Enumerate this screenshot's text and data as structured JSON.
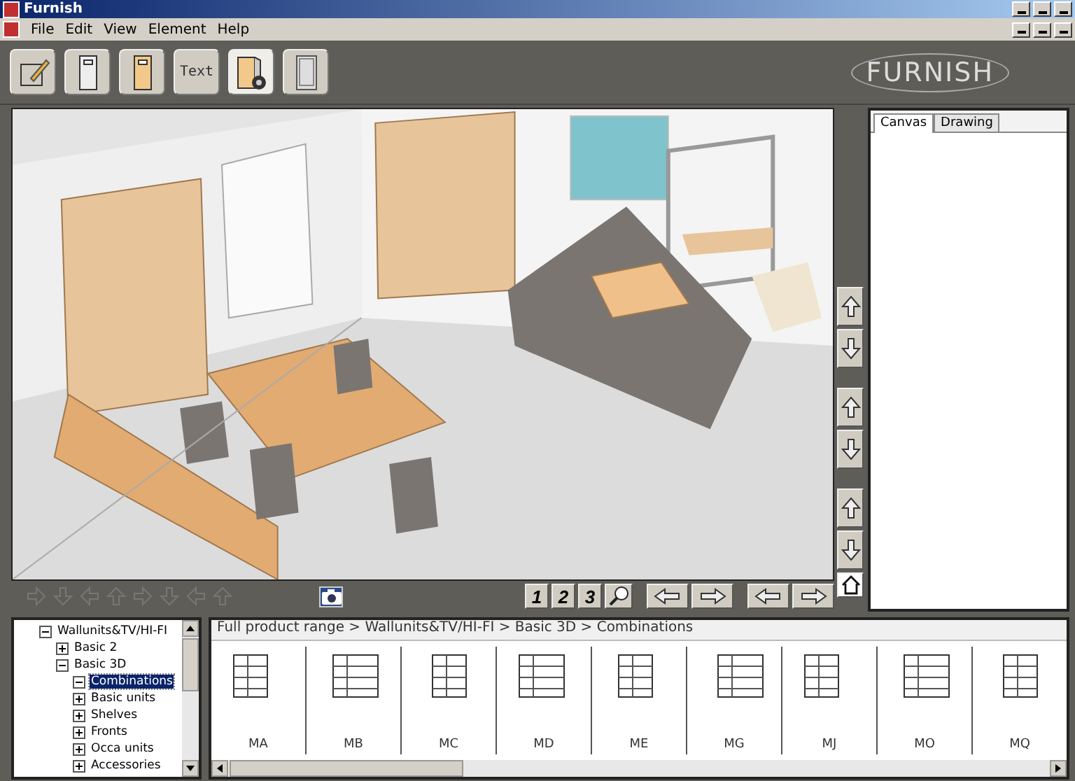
{
  "window": {
    "title": "Furnish"
  },
  "menu": [
    "File",
    "Edit",
    "View",
    "Element",
    "Help"
  ],
  "toolbar": [
    {
      "kind": "pencil",
      "selected": false
    },
    {
      "kind": "door",
      "selected": false
    },
    {
      "kind": "cabinet",
      "selected": false
    },
    {
      "kind": "text",
      "label": "Text",
      "selected": false
    },
    {
      "kind": "cabinet3d",
      "selected": true
    },
    {
      "kind": "calculator",
      "selected": false
    }
  ],
  "logo": "FURNISH",
  "tabs": [
    {
      "label": "Canvas",
      "selected": true
    },
    {
      "label": "Drawing",
      "selected": false
    }
  ],
  "view_pages": [
    {
      "label": "1"
    },
    {
      "label": "2"
    },
    {
      "label": "3"
    }
  ],
  "tree": [
    {
      "label": "Wallunits&TV/HI-FI",
      "expanded": true,
      "selected": false,
      "children": [
        {
          "label": "Basic 2",
          "expanded": false,
          "selected": false
        },
        {
          "label": "Basic 3D",
          "expanded": true,
          "selected": false,
          "children": [
            {
              "label": "Combinations",
              "expanded": true,
              "selected": true
            },
            {
              "label": "Basic units",
              "expanded": false,
              "selected": false
            },
            {
              "label": "Shelves",
              "expanded": false,
              "selected": false
            },
            {
              "label": "Fronts",
              "expanded": false,
              "selected": false
            },
            {
              "label": "Occa units",
              "expanded": false,
              "selected": false
            },
            {
              "label": "Accessories",
              "expanded": false,
              "selected": false
            }
          ]
        }
      ]
    }
  ],
  "breadcrumb": "Full product range > Wallunits&TV/HI-FI > Basic 3D > Combinations",
  "products": [
    "MA",
    "MB",
    "MC",
    "MD",
    "ME",
    "MG",
    "MJ",
    "MO",
    "MQ"
  ]
}
